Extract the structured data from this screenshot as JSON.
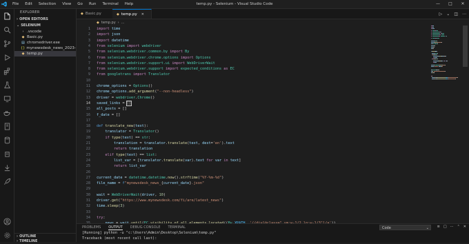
{
  "window": {
    "title": "temp.py - Selenium - Visual Studio Code",
    "menu": [
      "File",
      "Edit",
      "Selection",
      "View",
      "Go",
      "Run",
      "Terminal",
      "Help"
    ]
  },
  "sidebar": {
    "header": "EXPLORER",
    "open_editors": "OPEN EDITORS",
    "folder": "SELENIUM",
    "items": [
      {
        "label": ".vscode",
        "icon": "chevron-right-icon"
      },
      {
        "label": "Basic.py",
        "icon": "python-icon"
      },
      {
        "label": "chromedriver.exe",
        "icon": "file-icon"
      },
      {
        "label": "mynewsdesk_news_2023-07-...",
        "icon": "file-icon"
      },
      {
        "label": "temp.py",
        "icon": "python-icon"
      }
    ],
    "outline": "OUTLINE",
    "timeline": "TIMELINE"
  },
  "tabs": [
    {
      "label": "Basic.py"
    },
    {
      "label": "temp.py"
    }
  ],
  "breadcrumb": [
    "temp.py",
    "..."
  ],
  "editor": {
    "current_line": 14,
    "lines": [
      {
        "n": "1",
        "t": [
          [
            "kw",
            "import"
          ],
          [
            "pl",
            " "
          ],
          [
            "var",
            "time"
          ]
        ]
      },
      {
        "n": "2",
        "t": [
          [
            "kw",
            "import"
          ],
          [
            "pl",
            " "
          ],
          [
            "var",
            "json"
          ]
        ]
      },
      {
        "n": "3",
        "t": [
          [
            "kw",
            "import"
          ],
          [
            "pl",
            " "
          ],
          [
            "var",
            "datetime"
          ]
        ]
      },
      {
        "n": "4",
        "t": [
          [
            "kw",
            "from"
          ],
          [
            "pl",
            " "
          ],
          [
            "cls",
            "selenium"
          ],
          [
            "pl",
            " "
          ],
          [
            "kw",
            "import"
          ],
          [
            "pl",
            " "
          ],
          [
            "cls",
            "webdriver"
          ]
        ]
      },
      {
        "n": "5",
        "t": [
          [
            "kw",
            "from"
          ],
          [
            "pl",
            " "
          ],
          [
            "cls",
            "selenium.webdriver.common.by"
          ],
          [
            "pl",
            " "
          ],
          [
            "kw",
            "import"
          ],
          [
            "pl",
            " "
          ],
          [
            "cls",
            "By"
          ]
        ]
      },
      {
        "n": "6",
        "t": [
          [
            "kw",
            "from"
          ],
          [
            "pl",
            " "
          ],
          [
            "cls",
            "selenium.webdriver.chrome.options"
          ],
          [
            "pl",
            " "
          ],
          [
            "kw",
            "import"
          ],
          [
            "pl",
            " "
          ],
          [
            "cls",
            "Options"
          ]
        ]
      },
      {
        "n": "7",
        "t": [
          [
            "kw",
            "from"
          ],
          [
            "pl",
            " "
          ],
          [
            "cls",
            "selenium.webdriver.support.ui"
          ],
          [
            "pl",
            " "
          ],
          [
            "kw",
            "import"
          ],
          [
            "pl",
            " "
          ],
          [
            "cls",
            "WebDriverWait"
          ]
        ]
      },
      {
        "n": "8",
        "t": [
          [
            "kw",
            "from"
          ],
          [
            "pl",
            " "
          ],
          [
            "cls",
            "selenium.webdriver.support"
          ],
          [
            "pl",
            " "
          ],
          [
            "kw",
            "import"
          ],
          [
            "pl",
            " "
          ],
          [
            "cls",
            "expected_conditions"
          ],
          [
            "pl",
            " "
          ],
          [
            "kw",
            "as"
          ],
          [
            "pl",
            " "
          ],
          [
            "cls",
            "EC"
          ]
        ]
      },
      {
        "n": "9",
        "t": [
          [
            "kw",
            "from"
          ],
          [
            "pl",
            " "
          ],
          [
            "cls",
            "googletrans"
          ],
          [
            "pl",
            " "
          ],
          [
            "kw",
            "import"
          ],
          [
            "pl",
            " "
          ],
          [
            "cls",
            "Translator"
          ]
        ]
      },
      {
        "n": "10",
        "t": []
      },
      {
        "n": "11",
        "t": [
          [
            "var",
            "chrome_options"
          ],
          [
            "pl",
            " = "
          ],
          [
            "cls",
            "Options"
          ],
          [
            "pl",
            "()"
          ]
        ]
      },
      {
        "n": "12",
        "t": [
          [
            "var",
            "chrome_options"
          ],
          [
            "pl",
            "."
          ],
          [
            "fn",
            "add_argument"
          ],
          [
            "pl",
            "("
          ],
          [
            "str",
            "\"--non-headless\""
          ],
          [
            "pl",
            ")"
          ]
        ]
      },
      {
        "n": "13",
        "t": [
          [
            "var",
            "driver"
          ],
          [
            "pl",
            " = "
          ],
          [
            "cls",
            "webdriver"
          ],
          [
            "pl",
            "."
          ],
          [
            "cls",
            "Chrome"
          ],
          [
            "pl",
            "()"
          ]
        ]
      },
      {
        "n": "14",
        "t": [
          [
            "var",
            "saved_links"
          ],
          [
            "pl",
            " = "
          ],
          [
            "cursor",
            "[]"
          ]
        ]
      },
      {
        "n": "15",
        "t": [
          [
            "var",
            "all_posts"
          ],
          [
            "pl",
            " = []"
          ]
        ]
      },
      {
        "n": "16",
        "t": [
          [
            "var",
            "f_date"
          ],
          [
            "pl",
            " = []"
          ]
        ]
      },
      {
        "n": "17",
        "t": []
      },
      {
        "n": "18",
        "t": [
          [
            "kw2",
            "def"
          ],
          [
            "pl",
            " "
          ],
          [
            "fn",
            "translate_new"
          ],
          [
            "pl",
            "("
          ],
          [
            "var",
            "text"
          ],
          [
            "pl",
            "):"
          ]
        ]
      },
      {
        "n": "19",
        "t": [
          [
            "pl",
            "    "
          ],
          [
            "var",
            "translator"
          ],
          [
            "pl",
            " = "
          ],
          [
            "cls",
            "Translator"
          ],
          [
            "pl",
            "()"
          ]
        ]
      },
      {
        "n": "20",
        "t": [
          [
            "pl",
            "    "
          ],
          [
            "kw",
            "if"
          ],
          [
            "pl",
            " "
          ],
          [
            "fn",
            "type"
          ],
          [
            "pl",
            "("
          ],
          [
            "var",
            "text"
          ],
          [
            "pl",
            ") == "
          ],
          [
            "cls",
            "str"
          ],
          [
            "pl",
            ":"
          ]
        ]
      },
      {
        "n": "21",
        "t": [
          [
            "pl",
            "        "
          ],
          [
            "var",
            "translation"
          ],
          [
            "pl",
            " = "
          ],
          [
            "var",
            "translator"
          ],
          [
            "pl",
            "."
          ],
          [
            "fn",
            "translate"
          ],
          [
            "pl",
            "("
          ],
          [
            "var",
            "text"
          ],
          [
            "pl",
            ", "
          ],
          [
            "var",
            "dest"
          ],
          [
            "pl",
            "="
          ],
          [
            "str",
            "'en'"
          ],
          [
            "pl",
            ")."
          ],
          [
            "var",
            "text"
          ]
        ]
      },
      {
        "n": "22",
        "t": [
          [
            "pl",
            "        "
          ],
          [
            "kw",
            "return"
          ],
          [
            "pl",
            " "
          ],
          [
            "var",
            "translation"
          ]
        ]
      },
      {
        "n": "23",
        "t": [
          [
            "pl",
            "    "
          ],
          [
            "kw",
            "elif"
          ],
          [
            "pl",
            " "
          ],
          [
            "fn",
            "type"
          ],
          [
            "pl",
            "("
          ],
          [
            "var",
            "text"
          ],
          [
            "pl",
            ") == "
          ],
          [
            "cls",
            "list"
          ],
          [
            "pl",
            ":"
          ]
        ]
      },
      {
        "n": "24",
        "t": [
          [
            "pl",
            "        "
          ],
          [
            "var",
            "list_var"
          ],
          [
            "pl",
            " = ["
          ],
          [
            "var",
            "translator"
          ],
          [
            "pl",
            "."
          ],
          [
            "fn",
            "translate"
          ],
          [
            "pl",
            "("
          ],
          [
            "var",
            "var"
          ],
          [
            "pl",
            ")."
          ],
          [
            "var",
            "text"
          ],
          [
            "pl",
            " "
          ],
          [
            "kw",
            "for"
          ],
          [
            "pl",
            " "
          ],
          [
            "var",
            "var"
          ],
          [
            "pl",
            " "
          ],
          [
            "kw",
            "in"
          ],
          [
            "pl",
            " "
          ],
          [
            "var",
            "text"
          ],
          [
            "pl",
            "]"
          ]
        ]
      },
      {
        "n": "25",
        "t": [
          [
            "pl",
            "        "
          ],
          [
            "kw",
            "return"
          ],
          [
            "pl",
            " "
          ],
          [
            "var",
            "list_var"
          ]
        ]
      },
      {
        "n": "26",
        "t": []
      },
      {
        "n": "27",
        "t": [
          [
            "var",
            "current_date"
          ],
          [
            "pl",
            " = "
          ],
          [
            "cls",
            "datetime"
          ],
          [
            "pl",
            "."
          ],
          [
            "cls",
            "datetime"
          ],
          [
            "pl",
            "."
          ],
          [
            "fn",
            "now"
          ],
          [
            "pl",
            "()."
          ],
          [
            "fn",
            "strftime"
          ],
          [
            "pl",
            "("
          ],
          [
            "str",
            "\"%Y-%m-%d\""
          ],
          [
            "pl",
            ")"
          ]
        ]
      },
      {
        "n": "28",
        "t": [
          [
            "var",
            "file_name"
          ],
          [
            "pl",
            " = "
          ],
          [
            "kw2",
            "f"
          ],
          [
            "str",
            "\"mynewsdesk_news_"
          ],
          [
            "pl",
            "{"
          ],
          [
            "var",
            "current_date"
          ],
          [
            "pl",
            "}"
          ],
          [
            "str",
            ".json\""
          ]
        ]
      },
      {
        "n": "29",
        "t": []
      },
      {
        "n": "30",
        "t": [
          [
            "var",
            "wait"
          ],
          [
            "pl",
            " = "
          ],
          [
            "cls",
            "WebDriverWait"
          ],
          [
            "pl",
            "("
          ],
          [
            "var",
            "driver"
          ],
          [
            "pl",
            ", "
          ],
          [
            "num",
            "10"
          ],
          [
            "pl",
            ")"
          ]
        ]
      },
      {
        "n": "31",
        "t": [
          [
            "var",
            "driver"
          ],
          [
            "pl",
            "."
          ],
          [
            "fn",
            "get"
          ],
          [
            "pl",
            "("
          ],
          [
            "str",
            "\"https://www.mynewsdesk.com/fi/are/latest_news\""
          ],
          [
            "pl",
            ")"
          ]
        ]
      },
      {
        "n": "32",
        "t": [
          [
            "var",
            "time"
          ],
          [
            "pl",
            "."
          ],
          [
            "fn",
            "sleep"
          ],
          [
            "pl",
            "("
          ],
          [
            "num",
            "3"
          ],
          [
            "pl",
            ")"
          ]
        ]
      },
      {
        "n": "33",
        "t": []
      },
      {
        "n": "34",
        "t": [
          [
            "kw",
            "try"
          ],
          [
            "pl",
            ":"
          ]
        ]
      },
      {
        "n": "35",
        "t": [
          [
            "pl",
            "    "
          ],
          [
            "var",
            "news"
          ],
          [
            "pl",
            " = "
          ],
          [
            "var",
            "wait"
          ],
          [
            "pl",
            "."
          ],
          [
            "fn",
            "until"
          ],
          [
            "pl",
            "("
          ],
          [
            "cls",
            "EC"
          ],
          [
            "pl",
            "."
          ],
          [
            "fn",
            "visibility_of_all_elements_located"
          ],
          [
            "pl",
            "(("
          ],
          [
            "cls",
            "By"
          ],
          [
            "pl",
            "."
          ],
          [
            "con",
            "XPATH"
          ],
          [
            "pl",
            ", "
          ],
          [
            "str",
            "'//div[@class=\" sm:w-1/2 lg:w-1/3\"]/a'"
          ],
          [
            "pl",
            "))"
          ]
        ]
      },
      {
        "n": "36",
        "t": [
          [
            "pl",
            "    "
          ],
          [
            "var",
            "date"
          ],
          [
            "pl",
            " = "
          ],
          [
            "var",
            "wait"
          ],
          [
            "pl",
            "."
          ],
          [
            "fn",
            "until"
          ],
          [
            "pl",
            "("
          ],
          [
            "cls",
            "EC"
          ],
          [
            "pl",
            "."
          ],
          [
            "fn",
            "visibility_of_all_elements_located"
          ],
          [
            "pl",
            "(("
          ],
          [
            "cls",
            "By"
          ],
          [
            "pl",
            "."
          ],
          [
            "con",
            "XPATH"
          ],
          [
            "pl",
            ", "
          ],
          [
            "str",
            "'//time[@class=\"news\" data\"]'"
          ],
          [
            "pl",
            "))"
          ]
        ]
      }
    ]
  },
  "panel": {
    "tabs": [
      "PROBLEMS",
      "OUTPUT",
      "DEBUG CONSOLE",
      "TERMINAL"
    ],
    "active_tab": "OUTPUT",
    "select_value": "Code",
    "lines": [
      "[Running] python -u \"c:\\Users\\Admin\\Desktop\\Selenium\\temp.py\"",
      "Traceback (most recent call last):"
    ]
  }
}
